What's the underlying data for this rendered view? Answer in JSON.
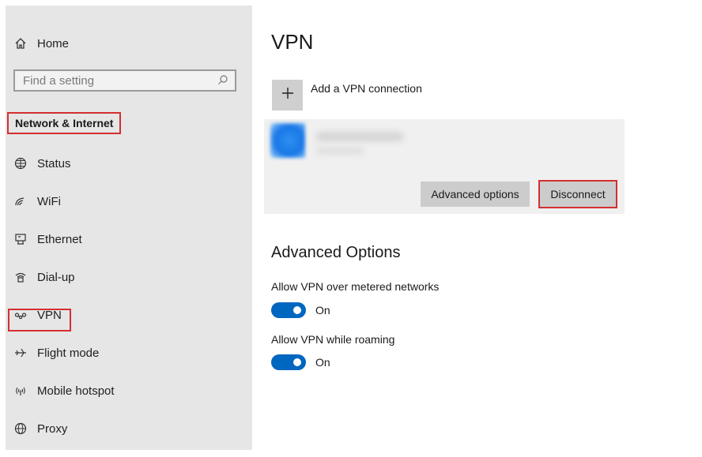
{
  "sidebar": {
    "home_label": "Home",
    "search_placeholder": "Find a setting",
    "section_title": "Network & Internet",
    "items": [
      {
        "label": "Status",
        "icon": "globe-icon"
      },
      {
        "label": "WiFi",
        "icon": "wifi-icon"
      },
      {
        "label": "Ethernet",
        "icon": "ethernet-icon"
      },
      {
        "label": "Dial-up",
        "icon": "dialup-icon"
      },
      {
        "label": "VPN",
        "icon": "vpn-icon"
      },
      {
        "label": "Flight mode",
        "icon": "airplane-icon"
      },
      {
        "label": "Mobile hotspot",
        "icon": "hotspot-icon"
      },
      {
        "label": "Proxy",
        "icon": "proxy-globe-icon"
      }
    ]
  },
  "main": {
    "title": "VPN",
    "add_label": "Add a VPN connection",
    "connection": {
      "advanced_button": "Advanced options",
      "disconnect_button": "Disconnect"
    },
    "advanced": {
      "heading": "Advanced Options",
      "metered": {
        "label": "Allow VPN over metered networks",
        "state": "On"
      },
      "roaming": {
        "label": "Allow VPN while roaming",
        "state": "On"
      }
    }
  },
  "colors": {
    "accent": "#0067c0",
    "highlight": "#d32f2f",
    "sidebar_bg": "#e6e6e6"
  }
}
